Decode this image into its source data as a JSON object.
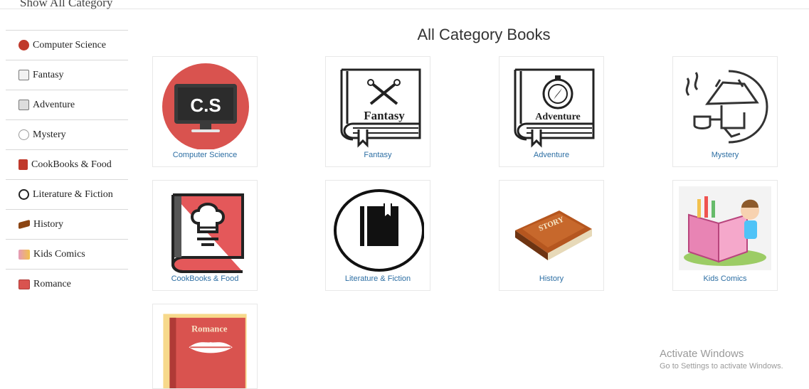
{
  "sidebar": {
    "header": "Show All Category",
    "items": [
      {
        "label": "Computer Science",
        "icon": "computer-icon",
        "color": "#d9534f"
      },
      {
        "label": "Fantasy",
        "icon": "fantasy-book-icon",
        "color": "#bbbbbb"
      },
      {
        "label": "Adventure",
        "icon": "adventure-book-icon",
        "color": "#aaaaaa"
      },
      {
        "label": "Mystery",
        "icon": "mystery-icon",
        "color": "#999999"
      },
      {
        "label": "CookBooks & Food",
        "icon": "cookbook-icon",
        "color": "#c0392b"
      },
      {
        "label": "Literature & Fiction",
        "icon": "literature-book-icon",
        "color": "#333333"
      },
      {
        "label": "History",
        "icon": "history-book-icon",
        "color": "#8b4513"
      },
      {
        "label": "Kids Comics",
        "icon": "kids-comics-icon",
        "color": "#e59ab8"
      },
      {
        "label": "Romance",
        "icon": "romance-book-icon",
        "color": "#d9534f"
      }
    ]
  },
  "main": {
    "title": "All Category Books",
    "cards": [
      {
        "label": "Computer Science",
        "art_text": "C.S",
        "icon": "cs-monitor-icon"
      },
      {
        "label": "Fantasy",
        "art_text": "Fantasy",
        "icon": "fantasy-book-icon"
      },
      {
        "label": "Adventure",
        "art_text": "Adventure",
        "icon": "adventure-book-icon"
      },
      {
        "label": "Mystery",
        "icon": "detective-icon"
      },
      {
        "label": "CookBooks & Food",
        "icon": "chef-hat-book-icon"
      },
      {
        "label": "Literature & Fiction",
        "icon": "literature-book-icon"
      },
      {
        "label": "History",
        "art_text": "STORY",
        "icon": "history-book-icon"
      },
      {
        "label": "Kids Comics",
        "icon": "kids-reading-icon"
      },
      {
        "label": "Romance",
        "art_text": "Romance",
        "icon": "romance-book-icon"
      }
    ]
  },
  "watermark": {
    "line1": "Activate Windows",
    "line2": "Go to Settings to activate Windows."
  },
  "colors": {
    "link": "#2c6ea3",
    "cs_red": "#d9534f",
    "cook_red": "#e4585a"
  }
}
